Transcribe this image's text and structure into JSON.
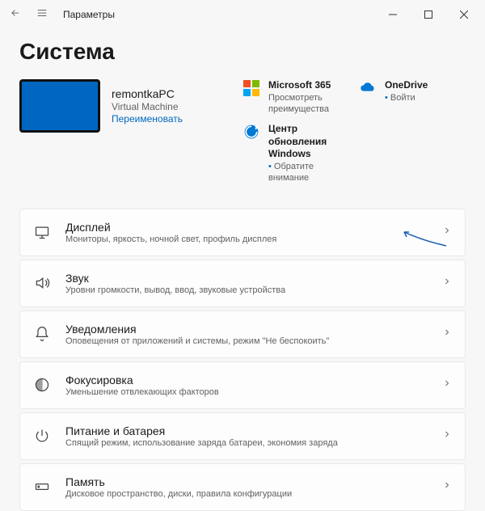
{
  "titlebar": {
    "label": "Параметры"
  },
  "page_title": "Система",
  "device": {
    "name": "remontkaPC",
    "type": "Virtual Machine",
    "rename": "Переименовать"
  },
  "promo": {
    "ms365": {
      "title": "Microsoft 365",
      "sub": "Просмотреть преимущества"
    },
    "onedrive": {
      "title": "OneDrive",
      "sub": "Войти"
    },
    "update": {
      "title": "Центр обновления Windows",
      "sub": "Обратите внимание"
    }
  },
  "rows": {
    "display": {
      "title": "Дисплей",
      "sub": "Мониторы, яркость, ночной свет, профиль дисплея"
    },
    "sound": {
      "title": "Звук",
      "sub": "Уровни громкости, вывод, ввод, звуковые устройства"
    },
    "notif": {
      "title": "Уведомления",
      "sub": "Оповещения от приложений и системы, режим \"Не беспокоить\""
    },
    "focus": {
      "title": "Фокусировка",
      "sub": "Уменьшение отвлекающих факторов"
    },
    "power": {
      "title": "Питание и батарея",
      "sub": "Спящий режим, использование заряда батареи, экономия заряда"
    },
    "storage": {
      "title": "Память",
      "sub": "Дисковое пространство, диски, правила конфигурации"
    }
  }
}
